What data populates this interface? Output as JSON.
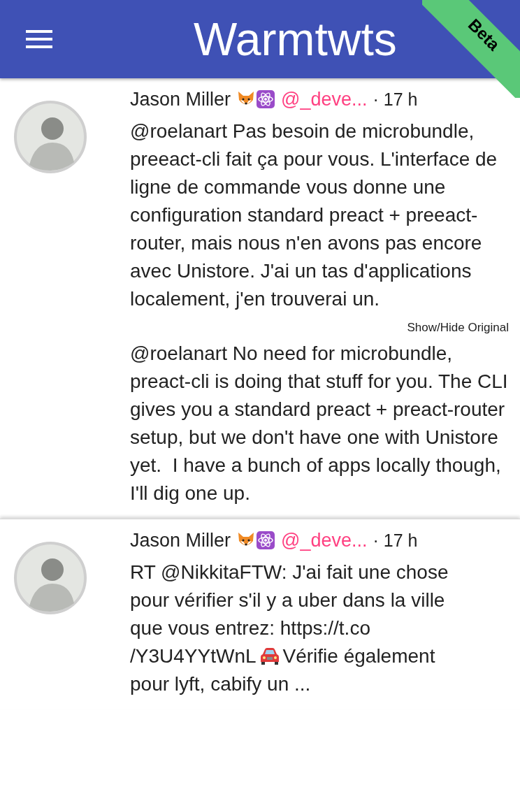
{
  "app_bar": {
    "title": "Warmtwts",
    "badge": "Beta"
  },
  "tweets": [
    {
      "author": "Jason Miller",
      "handle": "@_deve...",
      "time": "· 17 h",
      "body": [
        {
          "kind": "text",
          "text": "@roelanart Pas besoin de microbundle, preeact-cli fait ça pour vous. L'interface de ligne de commande vous donne une configuration standard preact + preeact-router, mais nous n'en avons pas encore avec Unistore. J'ai un tas d'applications localement, j'en trouverai un."
        }
      ],
      "toggle": "Show/Hide Original",
      "original": "@roelanart No need for microbundle, preact-cli is doing that stuff for you. The CLI gives you a standard preact + preact-router setup, but we don't have one with Unistore yet.  I have a bunch of apps locally though, I'll dig one up."
    },
    {
      "author": "Jason Miller",
      "handle": "@_deve...",
      "time": "· 17 h",
      "body_lines": [
        [
          {
            "kind": "text",
            "text": "RT @NikkitaFTW: J'ai fait une chose"
          }
        ],
        [
          {
            "kind": "text",
            "text": "pour vérifier s'il y a uber dans la ville"
          }
        ],
        [
          {
            "kind": "text",
            "text": "que vous entrez: https://t.co"
          }
        ],
        [
          {
            "kind": "text",
            "text": "/Y3U4YYtWnL"
          },
          {
            "kind": "car"
          },
          {
            "kind": "text",
            "text": "Vérifie également"
          }
        ],
        [
          {
            "kind": "text",
            "text": "pour lyft, cabify un ..."
          }
        ]
      ]
    }
  ]
}
